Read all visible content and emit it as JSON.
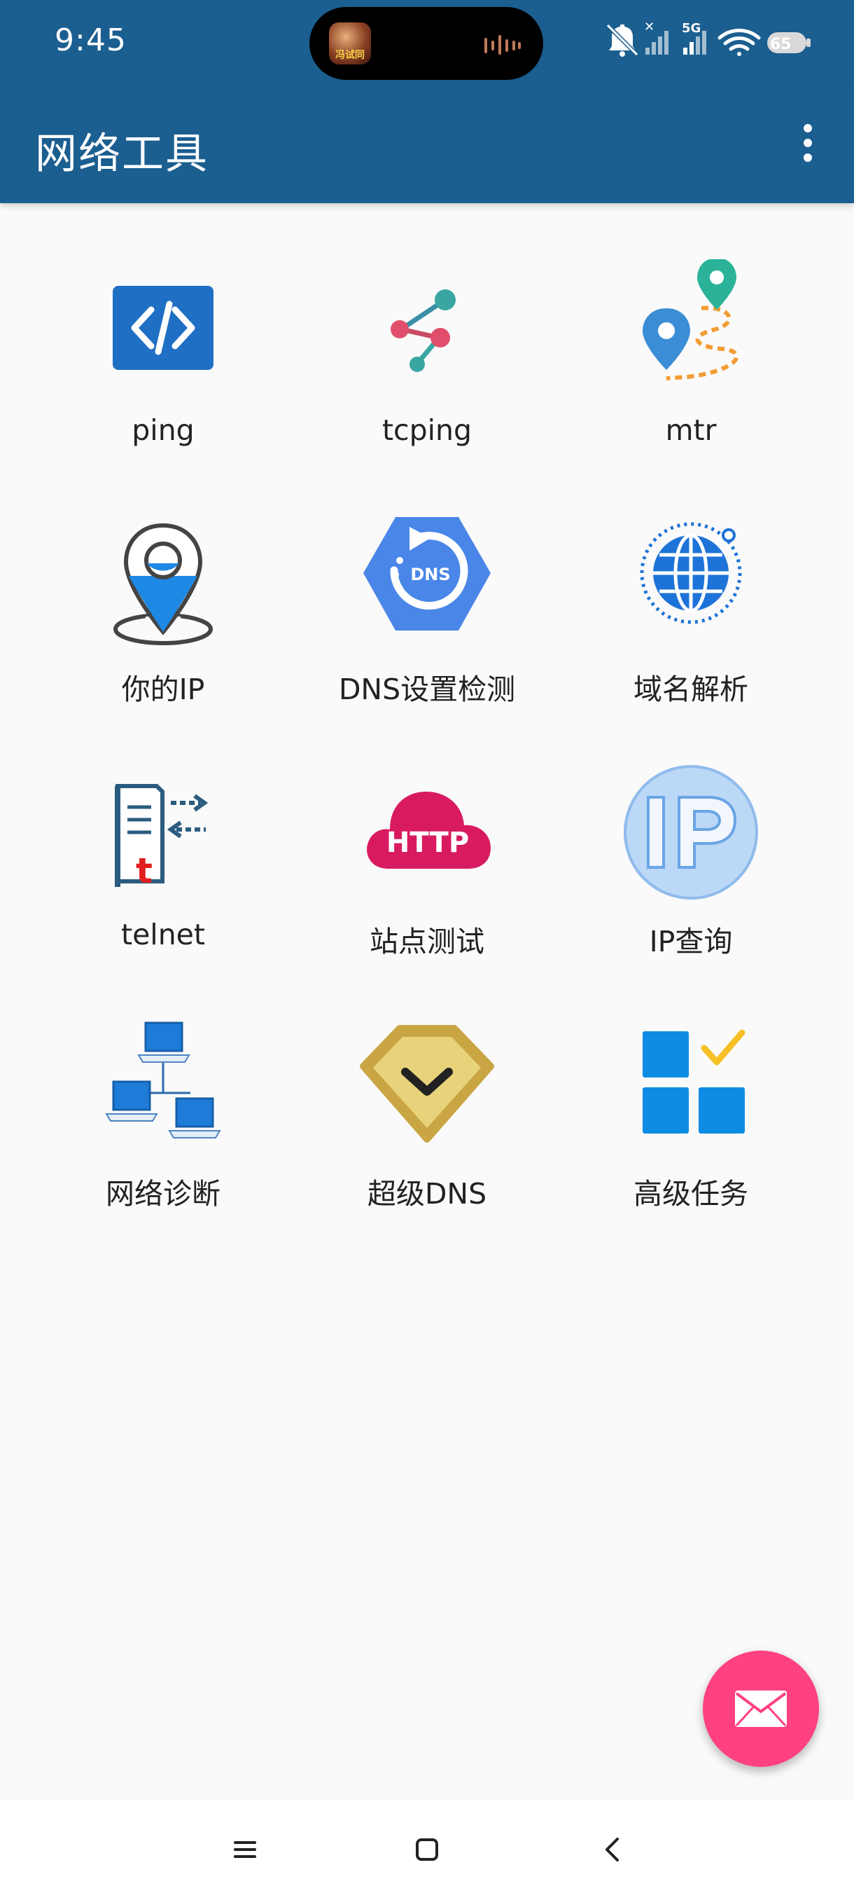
{
  "status_bar": {
    "time": "9:45",
    "island_app_text": "冯试同",
    "network_label": "5G",
    "battery_level": "65",
    "icons": [
      "bell-off-icon",
      "signal-icon",
      "signal-5g-icon",
      "wifi-icon",
      "battery-icon"
    ]
  },
  "app_bar": {
    "title": "网络工具",
    "menu_icon": "more-vert-icon"
  },
  "tools": [
    {
      "label": "ping",
      "icon": "code-icon"
    },
    {
      "label": "tcping",
      "icon": "share-nodes-icon"
    },
    {
      "label": "mtr",
      "icon": "route-pins-icon"
    },
    {
      "label": "你的IP",
      "icon": "location-pin-icon"
    },
    {
      "label": "DNS设置检测",
      "icon": "dns-hexagon-icon"
    },
    {
      "label": "域名解析",
      "icon": "globe-icon"
    },
    {
      "label": "telnet",
      "icon": "telnet-arrows-icon"
    },
    {
      "label": "站点测试",
      "icon": "http-cloud-icon"
    },
    {
      "label": "IP查询",
      "icon": "ip-circle-icon"
    },
    {
      "label": "网络诊断",
      "icon": "network-computers-icon"
    },
    {
      "label": "超级DNS",
      "icon": "shield-check-icon"
    },
    {
      "label": "高级任务",
      "icon": "grid-check-icon"
    }
  ],
  "colors": {
    "app_bar": "#1B5E90",
    "fab": "#FF4081",
    "background": "#FAFAFA"
  },
  "fab": {
    "icon": "mail-icon"
  },
  "nav_bar": {
    "icons": [
      "menu-icon",
      "home-square-icon",
      "back-chevron-icon"
    ]
  }
}
